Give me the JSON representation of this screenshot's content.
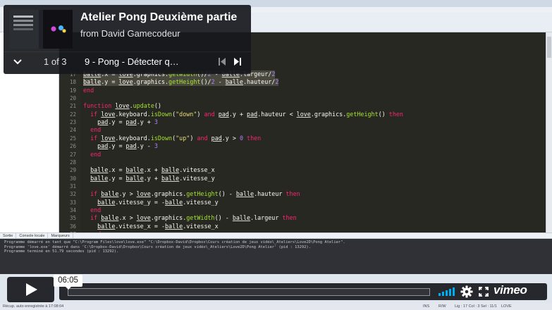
{
  "player": {
    "title": "Atelier Pong Deuxième partie",
    "byline": "from David Gamecodeur",
    "playlist_position": "1 of 3",
    "current_video": "9 - Pong - Détecter q…",
    "current_time": "06:05",
    "brand": "vimeo"
  },
  "editor": {
    "lines": [
      {
        "n": "17",
        "text": "balle.x = love.graphics.getWidth()/2 - balle.largeur/2"
      },
      {
        "n": "18",
        "text": "balle.y = love.graphics.getHeight()/2 - balle.hauteur/2"
      },
      {
        "n": "19",
        "text": "end"
      },
      {
        "n": "20",
        "text": ""
      },
      {
        "n": "21",
        "text": "function love.update()"
      },
      {
        "n": "22",
        "text": "  if love.keyboard.isDown(\"down\") and pad.y + pad.hauteur < love.graphics.getHeight() then"
      },
      {
        "n": "23",
        "text": "    pad.y = pad.y + 3"
      },
      {
        "n": "24",
        "text": "  end"
      },
      {
        "n": "25",
        "text": "  if love.keyboard.isDown(\"up\") and pad.y > 0 then"
      },
      {
        "n": "26",
        "text": "    pad.y = pad.y - 3"
      },
      {
        "n": "27",
        "text": "  end"
      },
      {
        "n": "28",
        "text": ""
      },
      {
        "n": "29",
        "text": "  balle.x = balle.x + balle.vitesse_x"
      },
      {
        "n": "30",
        "text": "  balle.y = balle.y + balle.vitesse_y"
      },
      {
        "n": "31",
        "text": ""
      },
      {
        "n": "32",
        "text": "  if balle.y > love.graphics.getHeight() - balle.hauteur then"
      },
      {
        "n": "33",
        "text": "    balle.vitesse_y = -balle.vitesse_y"
      },
      {
        "n": "34",
        "text": "  end"
      },
      {
        "n": "35",
        "text": "  if balle.x > love.graphics.getWidth() - balle.largeur then"
      },
      {
        "n": "36",
        "text": "    balle.vitesse_x = -balle.vitesse_x"
      },
      {
        "n": "37",
        "text": "  end"
      }
    ]
  },
  "output_panel": {
    "tabs": [
      "Sortie",
      "Console locale",
      "Marqueurs"
    ],
    "lines": [
      "Programme démarré en tant que \"C:\\Program Files\\love\\love.exe\" \"C:\\Dropbox-David\\Dropbox\\Cours création de jeux vidéo\\_Ateliers\\Love2D\\Pong Atelier\".",
      "Programme 'love.exe' démarré dans 'C:\\Dropbox-David\\Dropbox\\Cours création de jeux vidéo\\_Ateliers\\Love2D\\Pong Atelier' (pid : 13292).",
      "Programme terminé en 51.79 secondes (pid : 13292)."
    ]
  },
  "statusbar": {
    "left": "Récup. auto enregistrée à 17:08:04",
    "ins": "INS",
    "mode": "R/W",
    "pos": "Lig : 17 Col : 3 Sel : 11/1",
    "lang": "LOVE"
  },
  "colors": {
    "editor_bg": "#272822",
    "keyword": "#f92672",
    "function": "#a6e22e",
    "string": "#e6db74",
    "number": "#ae81ff",
    "vimeo_overlay": "#16181c"
  }
}
